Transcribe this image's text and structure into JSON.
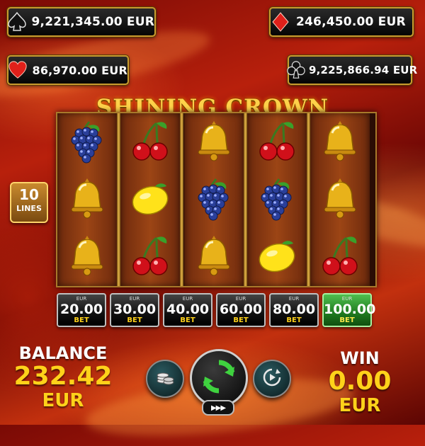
{
  "jackpots": {
    "spades": {
      "value": "9,221,345.00 EUR",
      "icon": "spade-icon"
    },
    "diamonds": {
      "value": "246,450.00 EUR",
      "icon": "diamond-icon"
    },
    "hearts": {
      "value": "86,970.00 EUR",
      "icon": "heart-icon"
    },
    "clubs": {
      "value": "9,225,866.94 EUR",
      "icon": "club-icon"
    }
  },
  "game": {
    "title": "SHINING CROWN"
  },
  "lines": {
    "count": "10",
    "label": "LINES"
  },
  "reels": [
    [
      "grapes",
      "bell",
      "bell"
    ],
    [
      "cherries",
      "lemon",
      "cherries"
    ],
    [
      "bell",
      "grapes",
      "bell"
    ],
    [
      "cherries",
      "grapes",
      "lemon"
    ],
    [
      "bell",
      "bell",
      "cherries"
    ]
  ],
  "bets": [
    {
      "currency": "EUR",
      "amount": "20.00",
      "label": "BET",
      "active": false
    },
    {
      "currency": "EUR",
      "amount": "30.00",
      "label": "BET",
      "active": false
    },
    {
      "currency": "EUR",
      "amount": "40.00",
      "label": "BET",
      "active": false
    },
    {
      "currency": "EUR",
      "amount": "60.00",
      "label": "BET",
      "active": false
    },
    {
      "currency": "EUR",
      "amount": "80.00",
      "label": "BET",
      "active": false
    },
    {
      "currency": "EUR",
      "amount": "100.00",
      "label": "BET",
      "active": true
    }
  ],
  "balance": {
    "label": "BALANCE",
    "value": "232.42",
    "currency": "EUR"
  },
  "win": {
    "label": "WIN",
    "value": "0.00",
    "currency": "EUR"
  },
  "controls": {
    "coins_icon": "coins-icon",
    "spin_icon": "spin-refresh-icon",
    "autoplay_icon": "autoplay-icon",
    "turbo_label": "▶▶▶"
  },
  "colors": {
    "gold": "#ffd21a",
    "active_bet": "#1f7a1f",
    "frame": "#c99a2e"
  }
}
